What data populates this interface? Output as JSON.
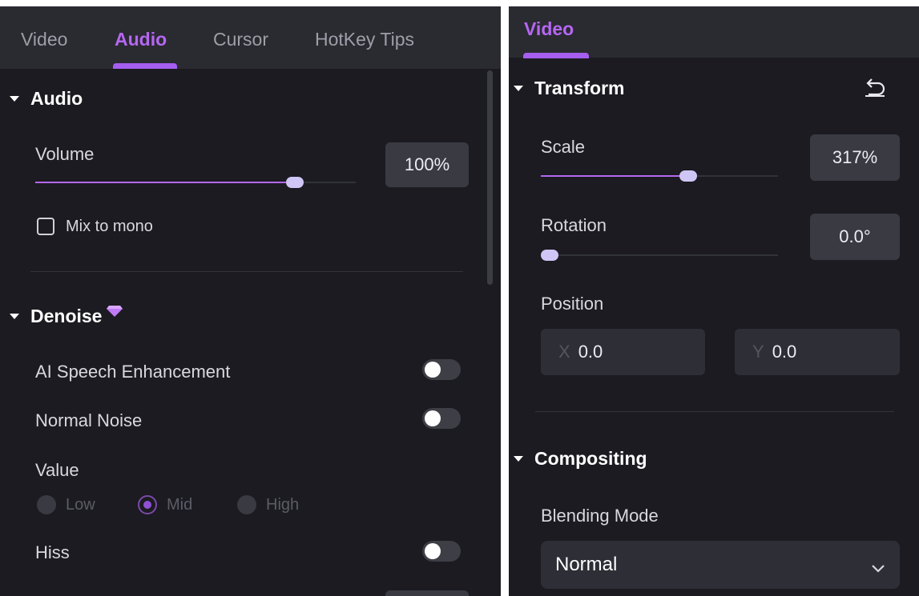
{
  "left_panel": {
    "tabs": [
      {
        "label": "Video",
        "active": false
      },
      {
        "label": "Audio",
        "active": true
      },
      {
        "label": "Cursor",
        "active": false
      },
      {
        "label": "HotKey Tips",
        "active": false
      }
    ],
    "audio_section": {
      "title": "Audio",
      "volume": {
        "label": "Volume",
        "value_text": "100%",
        "slider_fraction": 0.81
      },
      "mix_to_mono": {
        "label": "Mix to mono",
        "checked": false
      }
    },
    "denoise_section": {
      "title": "Denoise",
      "premium_icon": "diamond-icon",
      "ai_speech": {
        "label": "AI Speech Enhancement",
        "on": false
      },
      "normal_noise": {
        "label": "Normal Noise",
        "on": false
      },
      "value": {
        "label": "Value",
        "options": [
          "Low",
          "Mid",
          "High"
        ],
        "selected": "Mid"
      },
      "hiss": {
        "label": "Hiss",
        "on": false
      }
    }
  },
  "right_panel": {
    "tab": {
      "label": "Video",
      "active": true
    },
    "transform_section": {
      "title": "Transform",
      "reset_icon": "undo-icon",
      "scale": {
        "label": "Scale",
        "value_text": "317%",
        "slider_fraction": 0.62
      },
      "rotation": {
        "label": "Rotation",
        "value_text": "0.0°",
        "slider_fraction": 0.0
      },
      "position": {
        "label": "Position",
        "x_axis": "X",
        "x_value": "0.0",
        "y_axis": "Y",
        "y_value": "0.0"
      }
    },
    "compositing_section": {
      "title": "Compositing",
      "blending_mode": {
        "label": "Blending Mode",
        "selected": "Normal"
      }
    }
  },
  "colors": {
    "accent": "#b567f2",
    "panel_bg": "#1b1b21",
    "tabbar_bg": "#2a2a31"
  }
}
